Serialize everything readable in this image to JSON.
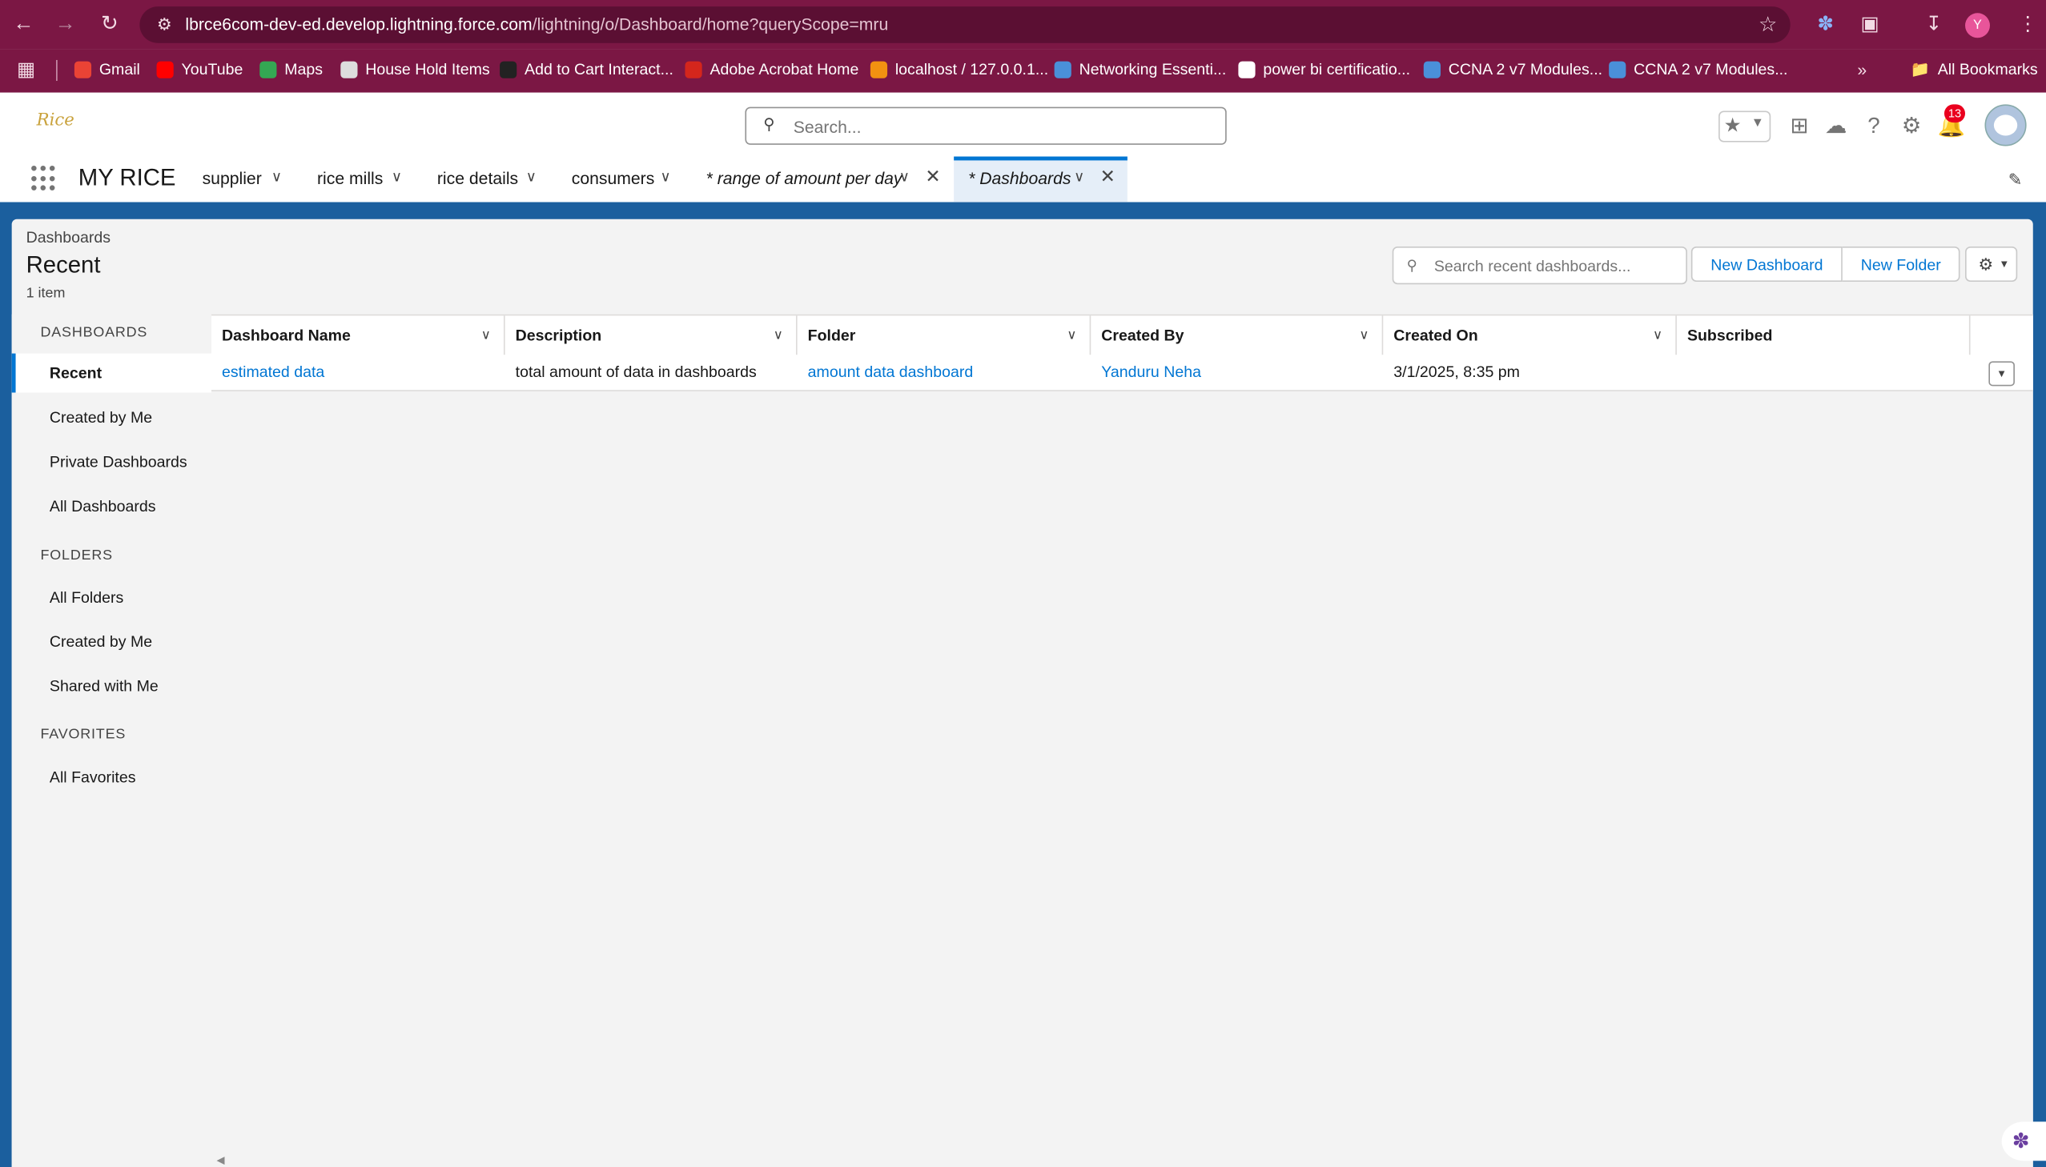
{
  "browser": {
    "url_host": "lbrce6com-dev-ed.develop.lightning.force.com",
    "url_path": "/lightning/o/Dashboard/home?queryScope=mru",
    "profile_initial": "Y",
    "bookmarks": [
      {
        "label": "Gmail",
        "icon": "gmail-icon",
        "color": "#ea4335"
      },
      {
        "label": "YouTube",
        "icon": "youtube-icon",
        "color": "#ff0000"
      },
      {
        "label": "Maps",
        "icon": "maps-icon",
        "color": "#34a853"
      },
      {
        "label": "House Hold Items",
        "icon": "globe-icon",
        "color": "#dddddd"
      },
      {
        "label": "Add to Cart Interact...",
        "icon": "bug-icon",
        "color": "#222222"
      },
      {
        "label": "Adobe Acrobat Home",
        "icon": "acrobat-icon",
        "color": "#d4261c"
      },
      {
        "label": "localhost / 127.0.0.1...",
        "icon": "phpmyadmin-icon",
        "color": "#f29111"
      },
      {
        "label": "Networking Essenti...",
        "icon": "link-icon",
        "color": "#4a90d9"
      },
      {
        "label": "power bi certificatio...",
        "icon": "google-icon",
        "color": "#ffffff"
      },
      {
        "label": "CCNA 2 v7 Modules...",
        "icon": "link-icon",
        "color": "#4a90d9"
      },
      {
        "label": "CCNA 2 v7 Modules...",
        "icon": "link-icon",
        "color": "#4a90d9"
      }
    ],
    "all_bookmarks_label": "All Bookmarks"
  },
  "header": {
    "logo_text": "Rice",
    "search_placeholder": "Search...",
    "notification_count": "13"
  },
  "app_nav": {
    "app_name": "MY RICE",
    "items": [
      {
        "label": "supplier"
      },
      {
        "label": "rice mills"
      },
      {
        "label": "rice details"
      },
      {
        "label": "consumers"
      },
      {
        "label": "* range of amount per day"
      },
      {
        "label": "* Dashboards"
      }
    ]
  },
  "list": {
    "breadcrumb": "Dashboards",
    "title": "Recent",
    "count": "1 item",
    "search_placeholder": "Search recent dashboards...",
    "new_dashboard_label": "New Dashboard",
    "new_folder_label": "New Folder"
  },
  "sidebar": {
    "dashboards_heading": "DASHBOARDS",
    "dashboards_items": [
      "Recent",
      "Created by Me",
      "Private Dashboards",
      "All Dashboards"
    ],
    "folders_heading": "FOLDERS",
    "folders_items": [
      "All Folders",
      "Created by Me",
      "Shared with Me"
    ],
    "favorites_heading": "FAVORITES",
    "favorites_items": [
      "All Favorites"
    ]
  },
  "table": {
    "columns": [
      "Dashboard Name",
      "Description",
      "Folder",
      "Created By",
      "Created On",
      "Subscribed"
    ],
    "rows": [
      {
        "name": "estimated data",
        "description": "total amount of data in dashboards",
        "folder": "amount data dashboard",
        "created_by": "Yanduru Neha",
        "created_on": "3/1/2025, 8:35 pm",
        "subscribed": ""
      }
    ]
  },
  "colors": {
    "browser_chrome": "#7b1744",
    "brand_blue": "#0176d3",
    "content_band": "#1b5f9e"
  }
}
